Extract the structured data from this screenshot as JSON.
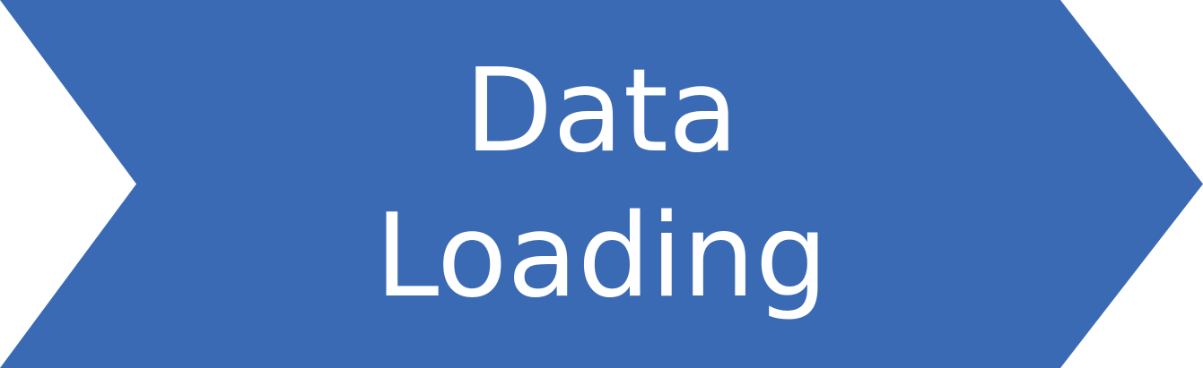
{
  "step": {
    "lines": [
      "Data",
      "Loading"
    ],
    "fill_color": "#3A6AB4",
    "text_color": "#FFFFFF"
  }
}
